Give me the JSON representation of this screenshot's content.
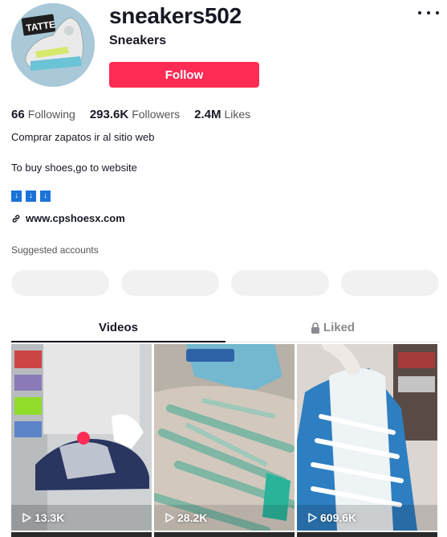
{
  "profile": {
    "username": "sneakers502",
    "nickname": "Sneakers",
    "follow_label": "Follow",
    "avatar_text": "TATTE",
    "more_icon": "more-horizontal-icon"
  },
  "stats": {
    "following_count": "66",
    "following_label": "Following",
    "followers_count": "293.6K",
    "followers_label": "Followers",
    "likes_count": "2.4M",
    "likes_label": "Likes"
  },
  "bio": {
    "line1": "Comprar zapatos ir al sitio web",
    "line2": "To buy shoes,go to website",
    "arrows": [
      "↓",
      "↓",
      "↓"
    ],
    "link": "www.cpshoesx.com",
    "link_icon": "link-icon"
  },
  "suggested": {
    "label": "Suggested accounts"
  },
  "tabs": {
    "videos": "Videos",
    "liked": "Liked",
    "liked_icon": "lock-icon"
  },
  "videos": [
    {
      "views": "13.3K",
      "play_icon": "play-icon"
    },
    {
      "views": "28.2K",
      "play_icon": "play-icon"
    },
    {
      "views": "609.6K",
      "play_icon": "play-icon"
    }
  ],
  "colors": {
    "accent": "#fe2c55",
    "text": "#161823",
    "muted": "#8a8b91",
    "pill": "#f1f1f2"
  }
}
